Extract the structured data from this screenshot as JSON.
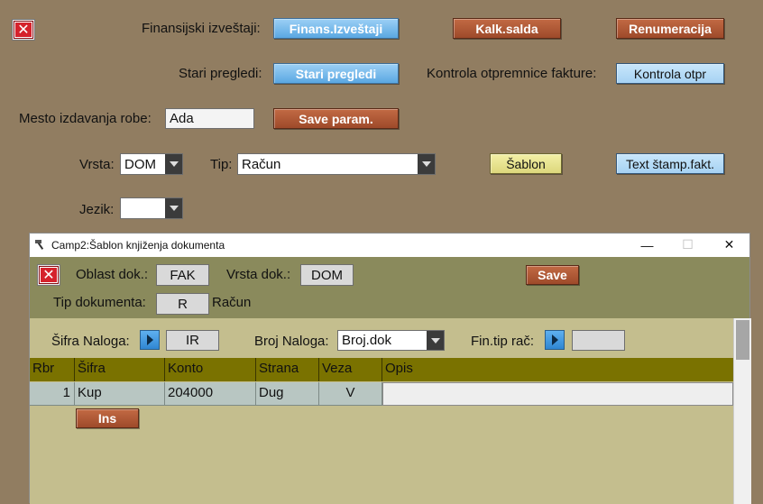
{
  "top": {
    "fin_label": "Finansijski izveštaji:",
    "fin_btn": "Finans.Izveštaji",
    "kalk_btn": "Kalk.salda",
    "renum_btn": "Renumeracija",
    "stari_label": "Stari pregledi:",
    "stari_btn": "Stari pregledi",
    "kontrola_label": "Kontrola otpremnice fakture:",
    "kontrola_btn": "Kontrola otpr",
    "mesto_label": "Mesto izdavanja robe:",
    "mesto_value": "Ada",
    "save_param_btn": "Save param.",
    "vrsta_label": "Vrsta:",
    "vrsta_value": "DOM",
    "tip_label": "Tip:",
    "tip_value": "Račun",
    "sablon_btn": "Šablon",
    "text_stamp_btn": "Text štamp.fakt.",
    "jezik_label": "Jezik:",
    "jezik_value": ""
  },
  "dialog": {
    "title": "Camp2:Šablon knjiženja dokumenta",
    "controls": {
      "minimize": "—",
      "maximize": "☐",
      "close": "✕"
    },
    "oblast_label": "Oblast dok.:",
    "oblast_value": "FAK",
    "vrsta_label": "Vrsta dok.:",
    "vrsta_value": "DOM",
    "save_btn": "Save",
    "tip_label": "Tip dokumenta:",
    "tip_value": "R",
    "tip_name": "Račun",
    "sifra_naloga_label": "Šifra Naloga:",
    "sifra_naloga_value": "IR",
    "broj_naloga_label": "Broj Naloga:",
    "broj_naloga_value": "Broj.dok",
    "fin_tip_label": "Fin.tip rač:",
    "fin_tip_value": "",
    "ins_btn": "Ins",
    "columns": [
      "Rbr",
      "Šifra",
      "Konto",
      "Strana",
      "Veza",
      "Opis"
    ],
    "rows": [
      {
        "rbr": "1",
        "sifra": "Kup",
        "konto": "204000",
        "strana": "Dug",
        "veza": "V",
        "opis": ""
      }
    ]
  },
  "colors": {
    "background": "#917d61",
    "dialog_header": "#8a8a5c",
    "dialog_body": "#c4be8e",
    "table_header": "#7a7200",
    "row_cells": "#b8c6c2"
  }
}
